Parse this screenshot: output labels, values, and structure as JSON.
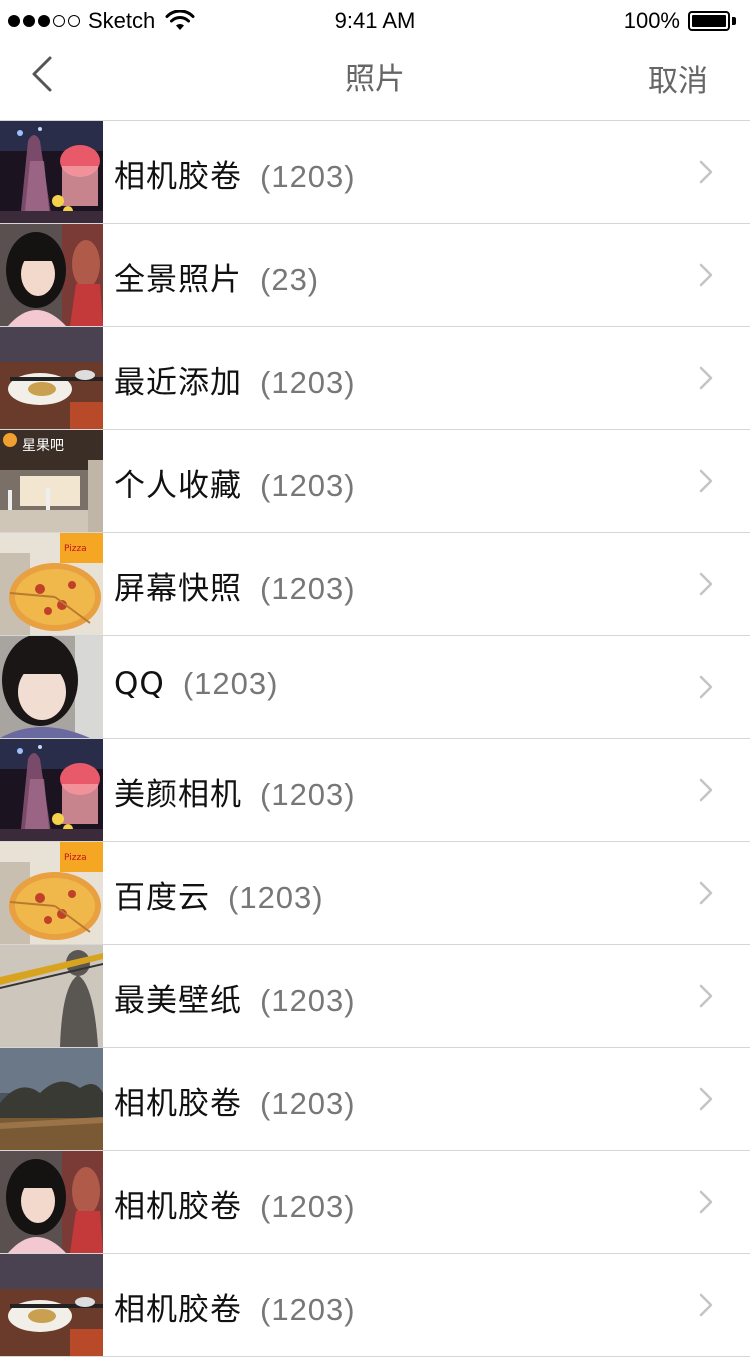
{
  "status_bar": {
    "carrier": "Sketch",
    "time": "9:41 AM",
    "battery": "100%"
  },
  "nav": {
    "title": "照片",
    "cancel_label": "取消",
    "back_icon": "chevron-left-icon"
  },
  "albums": [
    {
      "name": "相机胶卷",
      "count": "(1203)",
      "thumb": "dessert-drink"
    },
    {
      "name": "全景照片",
      "count": "(23)",
      "thumb": "girl-portrait"
    },
    {
      "name": "最近添加",
      "count": "(1203)",
      "thumb": "dinner-table"
    },
    {
      "name": "个人收藏",
      "count": "(1203)",
      "thumb": "shop-front"
    },
    {
      "name": "屏幕快照",
      "count": "(1203)",
      "thumb": "pizza"
    },
    {
      "name": "QQ",
      "count": "(1203)",
      "thumb": "girl-selfie"
    },
    {
      "name": "美颜相机",
      "count": "(1203)",
      "thumb": "dessert-drink"
    },
    {
      "name": "百度云",
      "count": "(1203)",
      "thumb": "pizza"
    },
    {
      "name": "最美壁纸",
      "count": "(1203)",
      "thumb": "shadow-wall"
    },
    {
      "name": "相机胶卷",
      "count": "(1203)",
      "thumb": "landscape"
    },
    {
      "name": "相机胶卷",
      "count": "(1203)",
      "thumb": "girl-portrait"
    },
    {
      "name": "相机胶卷",
      "count": "(1203)",
      "thumb": "dinner-table"
    }
  ],
  "colors": {
    "separator": "#d6d6d6",
    "secondary_text": "#777777",
    "nav_text": "#666666"
  }
}
